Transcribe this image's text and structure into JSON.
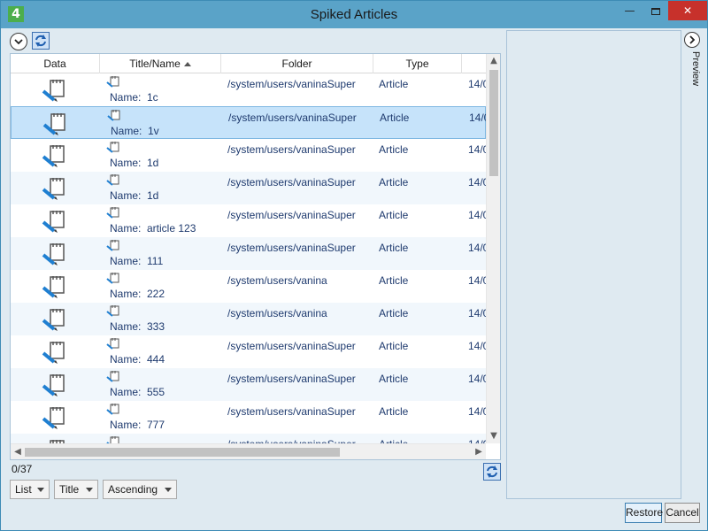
{
  "window": {
    "title": "Spiked Articles",
    "app_icon_text": "4"
  },
  "grid": {
    "columns": [
      "Data",
      "Title/Name",
      "Folder",
      "Type"
    ],
    "sorted_column": "Title/Name",
    "rows": [
      {
        "name_label": "Name:",
        "name": "1c",
        "folder": "/system/users/vaninaSuper",
        "type": "Article",
        "date": "14/0"
      },
      {
        "name_label": "Name:",
        "name": "1v",
        "folder": "/system/users/vaninaSuper",
        "type": "Article",
        "date": "14/0",
        "selected": true
      },
      {
        "name_label": "Name:",
        "name": "1d",
        "folder": "/system/users/vaninaSuper",
        "type": "Article",
        "date": "14/0"
      },
      {
        "name_label": "Name:",
        "name": "1d",
        "folder": "/system/users/vaninaSuper",
        "type": "Article",
        "date": "14/0"
      },
      {
        "name_label": "Name:",
        "name": "article 123",
        "folder": "/system/users/vaninaSuper",
        "type": "Article",
        "date": "14/0"
      },
      {
        "name_label": "Name:",
        "name": "111",
        "folder": "/system/users/vaninaSuper",
        "type": "Article",
        "date": "14/0"
      },
      {
        "name_label": "Name:",
        "name": "222",
        "folder": "/system/users/vanina",
        "type": "Article",
        "date": "14/0"
      },
      {
        "name_label": "Name:",
        "name": "333",
        "folder": "/system/users/vanina",
        "type": "Article",
        "date": "14/0"
      },
      {
        "name_label": "Name:",
        "name": "444",
        "folder": "/system/users/vaninaSuper",
        "type": "Article",
        "date": "14/0"
      },
      {
        "name_label": "Name:",
        "name": "555",
        "folder": "/system/users/vaninaSuper",
        "type": "Article",
        "date": "14/0"
      },
      {
        "name_label": "Name:",
        "name": "777",
        "folder": "/system/users/vaninaSuper",
        "type": "Article",
        "date": "14/0"
      },
      {
        "name_label": "",
        "name": "",
        "folder": "/system/users/vaninaSuper",
        "type": "Article",
        "date": "14/0"
      }
    ]
  },
  "footer": {
    "count": "0/37",
    "view_mode": "List",
    "sort_field": "Title",
    "sort_order": "Ascending"
  },
  "preview": {
    "label": "Preview"
  },
  "buttons": {
    "restore": "Restore",
    "cancel": "Cancel"
  },
  "colors": {
    "titlebar": "#5aa3c8",
    "selected_row": "#c6e3fa",
    "close_button": "#c7312b",
    "text": "#1e3a6e"
  }
}
